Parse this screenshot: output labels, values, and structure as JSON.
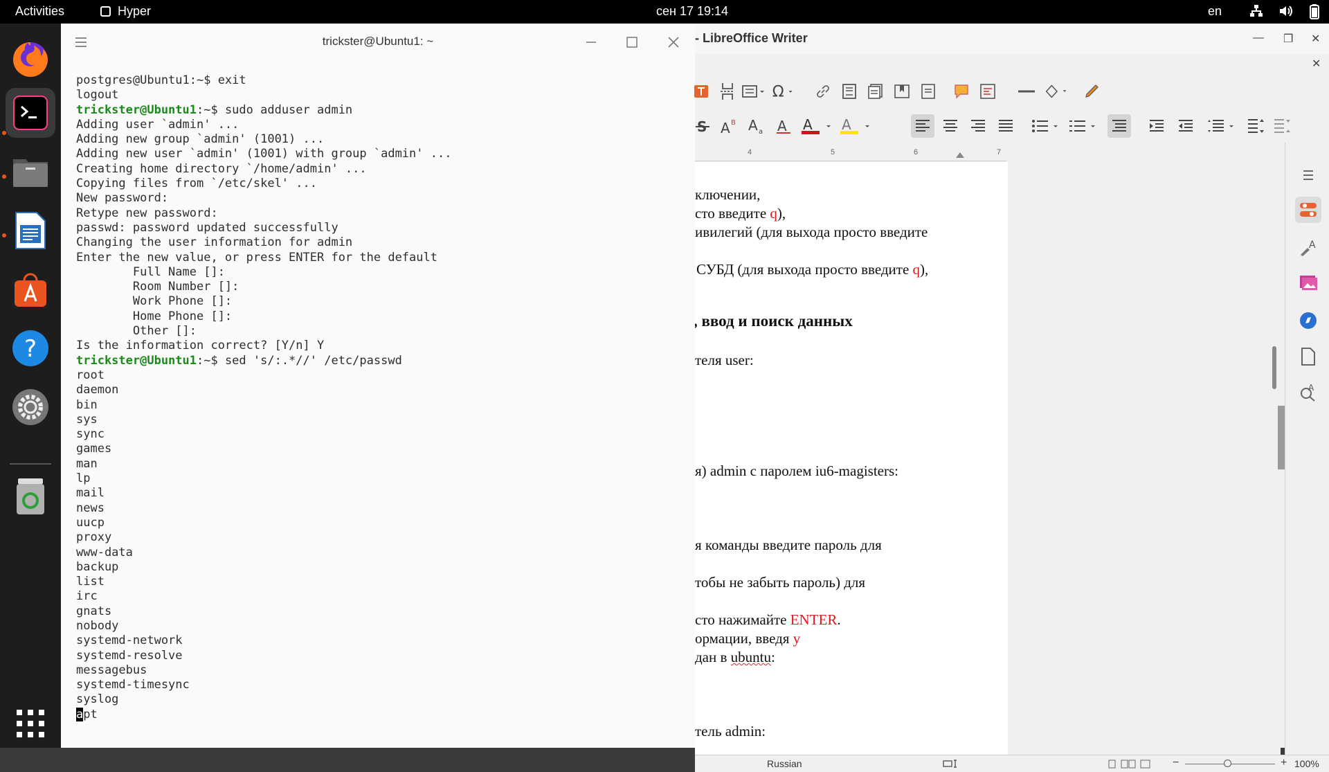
{
  "topbar": {
    "activities": "Activities",
    "app_name": "Hyper",
    "clock": "сен 17  19:14",
    "language": "en"
  },
  "dock": {
    "items": [
      "firefox-icon",
      "hyper-terminal-icon",
      "files-icon",
      "libreoffice-writer-icon",
      "software-center-icon",
      "help-icon",
      "settings-icon",
      "trash-icon",
      "show-apps-icon"
    ]
  },
  "terminal": {
    "title": "trickster@Ubuntu1: ~",
    "lines": [
      {
        "t": "postgres@Ubuntu1:~$ exit"
      },
      {
        "t": "logout"
      },
      {
        "p": "trickster@Ubuntu1",
        "s": ":~$ sudo adduser admin"
      },
      {
        "t": "Adding user `admin' ..."
      },
      {
        "t": "Adding new group `admin' (1001) ..."
      },
      {
        "t": "Adding new user `admin' (1001) with group `admin' ..."
      },
      {
        "t": "Creating home directory `/home/admin' ..."
      },
      {
        "t": "Copying files from `/etc/skel' ..."
      },
      {
        "t": "New password:"
      },
      {
        "t": "Retype new password:"
      },
      {
        "t": "passwd: password updated successfully"
      },
      {
        "t": "Changing the user information for admin"
      },
      {
        "t": "Enter the new value, or press ENTER for the default"
      },
      {
        "t": "        Full Name []:"
      },
      {
        "t": "        Room Number []:"
      },
      {
        "t": "        Work Phone []:"
      },
      {
        "t": "        Home Phone []:"
      },
      {
        "t": "        Other []:"
      },
      {
        "t": "Is the information correct? [Y/n] Y"
      },
      {
        "p": "trickster@Ubuntu1",
        "s": ":~$ sed 's/:.*//' /etc/passwd"
      },
      {
        "t": "root"
      },
      {
        "t": "daemon"
      },
      {
        "t": "bin"
      },
      {
        "t": "sys"
      },
      {
        "t": "sync"
      },
      {
        "t": "games"
      },
      {
        "t": "man"
      },
      {
        "t": "lp"
      },
      {
        "t": "mail"
      },
      {
        "t": "news"
      },
      {
        "t": "uucp"
      },
      {
        "t": "proxy"
      },
      {
        "t": "www-data"
      },
      {
        "t": "backup"
      },
      {
        "t": "list"
      },
      {
        "t": "irc"
      },
      {
        "t": "gnats"
      },
      {
        "t": "nobody"
      },
      {
        "t": "systemd-network"
      },
      {
        "t": "systemd-resolve"
      },
      {
        "t": "messagebus"
      },
      {
        "t": "systemd-timesync"
      },
      {
        "t": "syslog"
      },
      {
        "c": "a",
        "s": "pt"
      }
    ]
  },
  "writer": {
    "title": "- LibreOffice Writer",
    "ruler_numbers": [
      "4",
      "5",
      "6",
      "7"
    ],
    "document": {
      "line1": "ключении,",
      "line2_a": "сто введите ",
      "line2_b": "q",
      "line2_c": "),",
      "line3": "ивилегий (для выхода просто введите",
      "line4_a": "СУБД (для выхода просто введите ",
      "line4_b": "q",
      "line4_c": "),",
      "heading": ", ввод и поиск данных",
      "line6": "теля user:",
      "line7": "я) admin с паролем iu6-magisters:",
      "line8": "я команды введите пароль для",
      "line9": "тобы не забыть пароль) для",
      "line10_a": "сто нажимайте ",
      "line10_b": "ENTER",
      "line10_c": ".",
      "line11_a": "ормации, введя ",
      "line11_b": "y",
      "line12_a": "дан в ",
      "line12_b": "ubuntu",
      "line12_c": ":",
      "line13": "тель admin:"
    },
    "status": {
      "language": "Russian",
      "zoom": "100%"
    }
  },
  "colors": {
    "prompt_green": "#1a8a1a",
    "doc_red": "#e0161b",
    "ubuntu_orange": "#e95420"
  }
}
